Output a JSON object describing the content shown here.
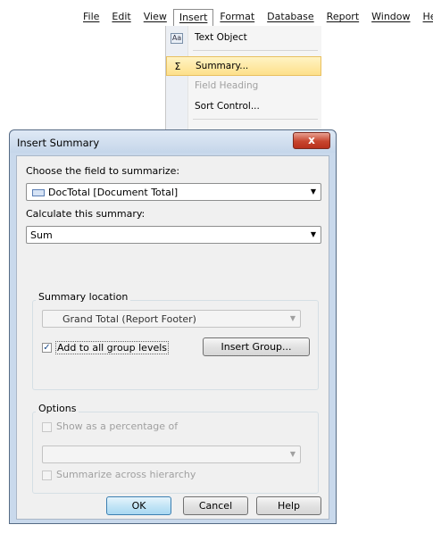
{
  "menubar": {
    "items": [
      "File",
      "Edit",
      "View",
      "Insert",
      "Format",
      "Database",
      "Report",
      "Window",
      "Hel"
    ]
  },
  "insert_menu": {
    "items": [
      {
        "icon": "Aa",
        "label": "Text Object",
        "state": "normal"
      },
      {
        "icon": "Σ",
        "label": "Summary...",
        "state": "highlighted"
      },
      {
        "icon": "",
        "label": "Field Heading",
        "state": "disabled"
      },
      {
        "icon": "",
        "label": "Sort Control...",
        "state": "normal"
      }
    ]
  },
  "dialog": {
    "title": "Insert Summary",
    "close_glyph": "x",
    "field_label": "Choose the field to summarize:",
    "field_value": "DocTotal [Document Total]",
    "calc_label": "Calculate this summary:",
    "calc_value": "Sum",
    "location_group": "Summary location",
    "location_value": "Grand Total (Report Footer)",
    "add_group_levels": {
      "label": "Add to all group levels",
      "checked": true
    },
    "insert_group_button": "Insert Group...",
    "options_group": "Options",
    "show_percentage": {
      "label": "Show as a percentage of",
      "checked": false
    },
    "percentage_value": "",
    "summarize_hierarchy": {
      "label": "Summarize across hierarchy",
      "checked": false
    },
    "ok_button": "OK",
    "cancel_button": "Cancel",
    "help_button": "Help"
  }
}
